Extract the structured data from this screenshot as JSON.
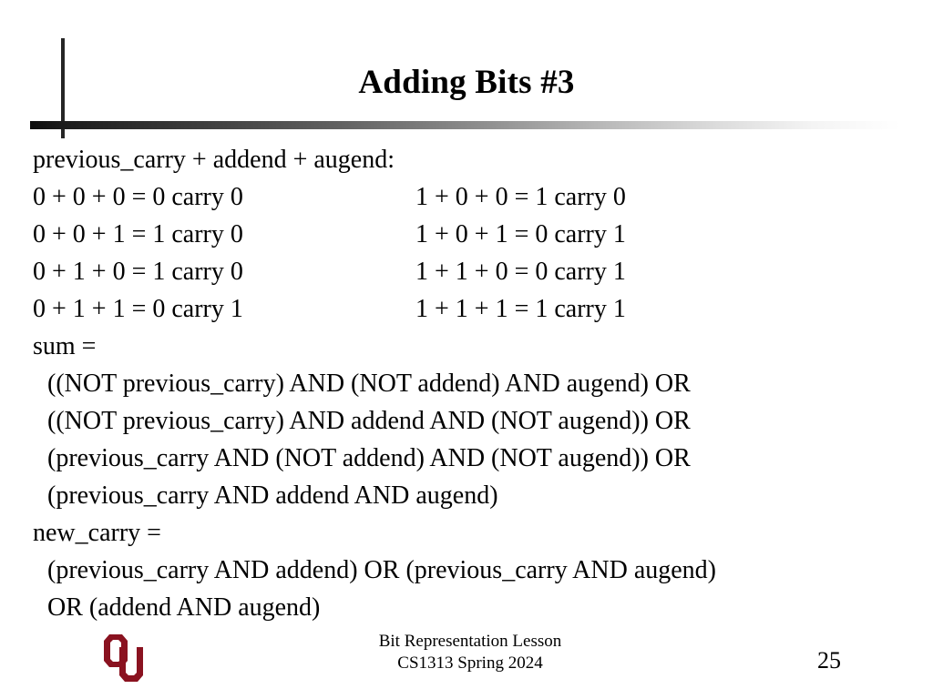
{
  "slide": {
    "title": "Adding Bits #3",
    "intro": "previous_carry + addend + augend:",
    "truth_table": [
      {
        "left": "0 + 0 + 0 = 0 carry 0",
        "right": "1 + 0 + 0 = 1 carry 0"
      },
      {
        "left": "0 + 0 + 1 = 1 carry 0",
        "right": "1 + 0 + 1 = 0 carry 1"
      },
      {
        "left": "0 + 1 + 0 = 1 carry 0",
        "right": "1 + 1 + 0 = 0 carry 1"
      },
      {
        "left": "0 + 1 + 1 = 0 carry 1",
        "right": "1 + 1 + 1 = 1 carry 1"
      }
    ],
    "sum_label": "sum =",
    "sum_lines": [
      "((NOT previous_carry) AND (NOT addend) AND augend) OR",
      "((NOT previous_carry) AND addend AND (NOT augend)) OR",
      "(previous_carry AND (NOT addend) AND (NOT augend)) OR",
      "(previous_carry AND addend AND augend)"
    ],
    "new_carry_label": "new_carry =",
    "new_carry_lines": [
      "(previous_carry AND addend) OR (previous_carry AND augend)",
      "OR (addend AND augend)"
    ]
  },
  "footer": {
    "logo_icon": "ou-logo-icon",
    "logo_color": "#8a1220",
    "line1": "Bit Representation Lesson",
    "line2": "CS1313 Spring 2024",
    "slide_number": "25"
  }
}
